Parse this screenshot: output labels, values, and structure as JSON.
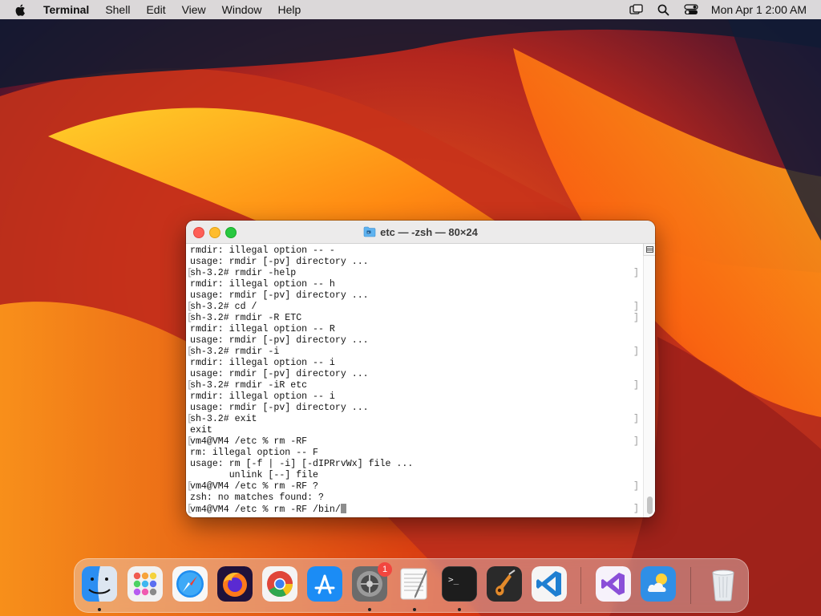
{
  "menubar": {
    "app_name": "Terminal",
    "menus": [
      "Shell",
      "Edit",
      "View",
      "Window",
      "Help"
    ],
    "clock": "Mon Apr 1  2:00 AM",
    "icons": [
      "apple-icon",
      "screen-mirroring-icon",
      "spotlight-search-icon",
      "control-center-icon"
    ]
  },
  "window": {
    "title": "etc — -zsh — 80×24",
    "lines": [
      {
        "text": "rmdir: illegal option -- -",
        "bracket": false
      },
      {
        "text": "usage: rmdir [-pv] directory ...",
        "bracket": false
      },
      {
        "text": "sh-3.2# rmdir -help",
        "bracket": true
      },
      {
        "text": "rmdir: illegal option -- h",
        "bracket": false
      },
      {
        "text": "usage: rmdir [-pv] directory ...",
        "bracket": false
      },
      {
        "text": "sh-3.2# cd /",
        "bracket": true
      },
      {
        "text": "sh-3.2# rmdir -R ETC",
        "bracket": true
      },
      {
        "text": "rmdir: illegal option -- R",
        "bracket": false
      },
      {
        "text": "usage: rmdir [-pv] directory ...",
        "bracket": false
      },
      {
        "text": "sh-3.2# rmdir -i",
        "bracket": true
      },
      {
        "text": "rmdir: illegal option -- i",
        "bracket": false
      },
      {
        "text": "usage: rmdir [-pv] directory ...",
        "bracket": false
      },
      {
        "text": "sh-3.2# rmdir -iR etc",
        "bracket": true
      },
      {
        "text": "rmdir: illegal option -- i",
        "bracket": false
      },
      {
        "text": "usage: rmdir [-pv] directory ...",
        "bracket": false
      },
      {
        "text": "sh-3.2# exit",
        "bracket": true
      },
      {
        "text": "exit",
        "bracket": false
      },
      {
        "text": "vm4@VM4 /etc % rm -RF",
        "bracket": true
      },
      {
        "text": "rm: illegal option -- F",
        "bracket": false
      },
      {
        "text": "usage: rm [-f | -i] [-dIPRrvWx] file ...",
        "bracket": false
      },
      {
        "text": "       unlink [--] file",
        "bracket": false
      },
      {
        "text": "vm4@VM4 /etc % rm -RF ?",
        "bracket": true
      },
      {
        "text": "zsh: no matches found: ?",
        "bracket": false
      },
      {
        "text": "vm4@VM4 /etc % rm -RF /bin/",
        "bracket": true,
        "cursor": true
      }
    ]
  },
  "dock": {
    "apps": [
      {
        "name": "Finder",
        "icon": "finder-icon",
        "running": true
      },
      {
        "name": "Launchpad",
        "icon": "launchpad-icon",
        "running": false
      },
      {
        "name": "Safari",
        "icon": "safari-icon",
        "running": false
      },
      {
        "name": "Firefox",
        "icon": "firefox-icon",
        "running": false
      },
      {
        "name": "Google Chrome",
        "icon": "chrome-icon",
        "running": false
      },
      {
        "name": "App Store",
        "icon": "app-store-icon",
        "running": false
      },
      {
        "name": "System Preferences",
        "icon": "system-preferences-icon",
        "running": true,
        "badge": "1"
      },
      {
        "name": "TextEdit",
        "icon": "textedit-icon",
        "running": true
      },
      {
        "name": "Terminal",
        "icon": "terminal-icon",
        "running": true
      },
      {
        "name": "GarageBand",
        "icon": "garageband-icon",
        "running": false
      },
      {
        "name": "Visual Studio Code",
        "icon": "vscode-icon",
        "running": false
      },
      {
        "name": "Visual Studio",
        "icon": "visual-studio-icon",
        "running": false
      },
      {
        "name": "Weather",
        "icon": "weather-icon",
        "running": false
      },
      {
        "name": "Trash",
        "icon": "trash-icon",
        "running": false
      }
    ]
  }
}
